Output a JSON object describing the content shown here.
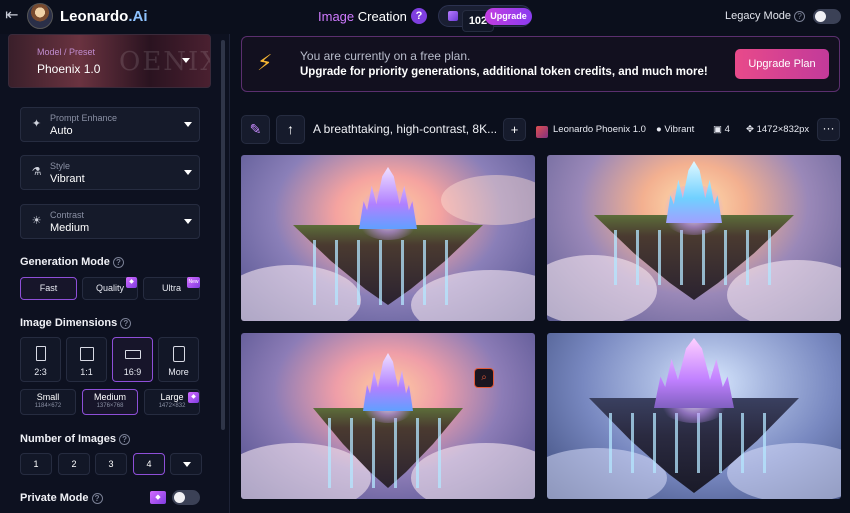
{
  "header": {
    "back_icon": "back-arrow-icon",
    "brand_name": "Leonardo",
    "brand_suffix": ".Ai",
    "title_icon_word": "Image",
    "title_word": "Creation",
    "help": "?",
    "token_count": "102",
    "upgrade_label": "Upgrade",
    "legacy_mode_label": "Legacy Mode",
    "legacy_mode_on": false
  },
  "sidebar": {
    "model": {
      "label": "Model / Preset",
      "value": "Phoenix 1.0",
      "watermark": "OENIX"
    },
    "prompt_enhance": {
      "label": "Prompt Enhance",
      "value": "Auto"
    },
    "style": {
      "label": "Style",
      "value": "Vibrant"
    },
    "contrast": {
      "label": "Contrast",
      "value": "Medium"
    },
    "generation_mode": {
      "label": "Generation Mode",
      "options": [
        "Fast",
        "Quality",
        "Ultra"
      ],
      "selected": "Fast",
      "ultra_badge": "New"
    },
    "image_dimensions": {
      "label": "Image Dimensions",
      "ratios": [
        "2:3",
        "1:1",
        "16:9",
        "More"
      ],
      "selected_ratio": "16:9",
      "sizes": [
        {
          "name": "Small",
          "px": "1184×672"
        },
        {
          "name": "Medium",
          "px": "1376×768"
        },
        {
          "name": "Large",
          "px": "1472×832"
        }
      ],
      "selected_size": "Medium"
    },
    "number_of_images": {
      "label": "Number of Images",
      "options": [
        "1",
        "2",
        "3",
        "4"
      ],
      "selected": "4"
    },
    "private_mode": {
      "label": "Private Mode",
      "on": false
    }
  },
  "banner": {
    "line1": "You are currently on a free plan.",
    "line2": "Upgrade for priority generations, additional token credits, and much more!",
    "cta": "Upgrade Plan"
  },
  "generation": {
    "prompt": "A breathtaking, high-contrast, 8K...",
    "model": "Leonardo Phoenix 1.0",
    "style": "Vibrant",
    "count": "4",
    "dimensions": "1472×832px",
    "more": "···"
  },
  "images": [
    {
      "name": "floating-island-castle-1"
    },
    {
      "name": "floating-island-castle-2"
    },
    {
      "name": "floating-island-castle-3"
    },
    {
      "name": "floating-island-castle-4"
    }
  ],
  "colors": {
    "accent": "#8e4fd8",
    "upgrade": "#c33ee0",
    "cta": "#e84a8a",
    "bolt": "#f7b733"
  }
}
